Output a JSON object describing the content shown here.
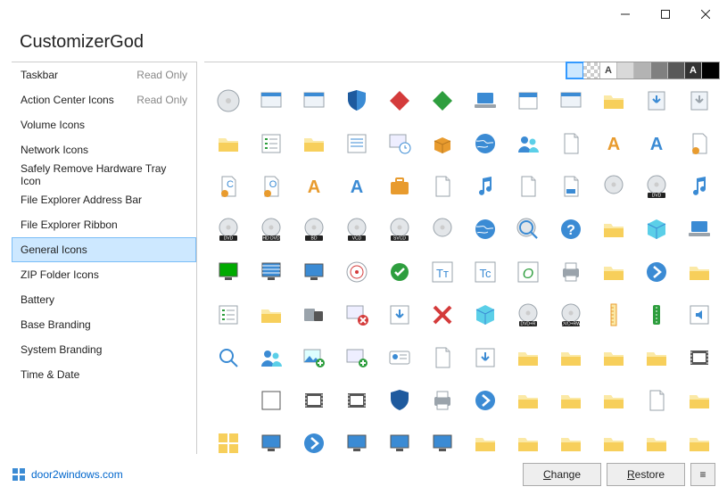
{
  "app_title": "CustomizerGod",
  "window_controls": {
    "minimize": "minimize",
    "maximize": "maximize",
    "close": "close"
  },
  "sidebar": {
    "items": [
      {
        "label": "Taskbar",
        "read_only": "Read Only"
      },
      {
        "label": "Action Center Icons",
        "read_only": "Read Only"
      },
      {
        "label": "Volume Icons"
      },
      {
        "label": "Network Icons"
      },
      {
        "label": "Safely Remove Hardware Tray Icon"
      },
      {
        "label": "File Explorer Address Bar"
      },
      {
        "label": "File Explorer Ribbon"
      },
      {
        "label": "General Icons",
        "selected": true
      },
      {
        "label": "ZIP Folder Icons"
      },
      {
        "label": "Battery"
      },
      {
        "label": "Base Branding"
      },
      {
        "label": "System Branding"
      },
      {
        "label": "Time & Date"
      }
    ]
  },
  "swatches": [
    {
      "bg": "#cde8ff",
      "sel": true
    },
    {
      "bg": "checker"
    },
    {
      "bg": "#ffffff",
      "letter": "A"
    },
    {
      "bg": "#d9d9d9"
    },
    {
      "bg": "#b3b3b3"
    },
    {
      "bg": "#808080"
    },
    {
      "bg": "#595959"
    },
    {
      "bg": "#333333",
      "letter": "A",
      "fg": "#fff"
    },
    {
      "bg": "#000000"
    }
  ],
  "footer": {
    "brand_label": "door2windows.com",
    "change_label": "Change",
    "restore_label": "Restore",
    "menu_label": "≡"
  },
  "icons": [
    "disc-gray",
    "rect-gray",
    "window-small",
    "shield-blue",
    "diamond-red",
    "diamond-green",
    "laptop",
    "calendar",
    "app-window",
    "folder-install",
    "install-blue",
    "install-gray",
    "folder",
    "checklist",
    "star-folder",
    "list",
    "window-clock",
    "box-open",
    "globe",
    "people-blue",
    "paper",
    "font-orange",
    "font-open",
    "cert-blue",
    "cert-c",
    "cert-o",
    "a-orange",
    "a-blue",
    "briefcase",
    "doc-exe",
    "music-note",
    "doc-gray",
    "doc-blue",
    "dvd-disc",
    "dvd-label",
    "music-big",
    "dvd-black",
    "hddvd",
    "bd",
    "vcd",
    "svcd",
    "cd-plain",
    "globe-down",
    "magnify-disc",
    "help-disc",
    "folder-cyan",
    "cube-blue",
    "laptop-blue",
    "monitor-green",
    "monitor-stripe",
    "monitors",
    "target",
    "check-green",
    "font-tt",
    "font-tc",
    "font-o",
    "printer",
    "folder-plain",
    "nav-right",
    "folder-tile",
    "checklist2",
    "folder-yellow",
    "device-pair",
    "window-x",
    "arrow-down",
    "x-red",
    "cube-out",
    "dvdr",
    "dvdrw",
    "ruler",
    "zip-green",
    "speaker",
    "magnify",
    "people",
    "mountain-plus",
    "plus-green",
    "id-card",
    "docs",
    "arrow-down-big",
    "folder2",
    "folder3",
    "folder-tile2",
    "folder-dark",
    "film",
    "blank",
    "blank-outline",
    "film-strip",
    "film-strip2",
    "shield-solid",
    "printer-3d",
    "nav-right2",
    "folder4",
    "folder5",
    "folder6",
    "docs2",
    "folder7",
    "tiles",
    "monitor",
    "nav-blue",
    "monitor2",
    "monitors2",
    "monitor3",
    "folders",
    "folder8",
    "folder9",
    "folder10",
    "folder11",
    "folder12"
  ]
}
